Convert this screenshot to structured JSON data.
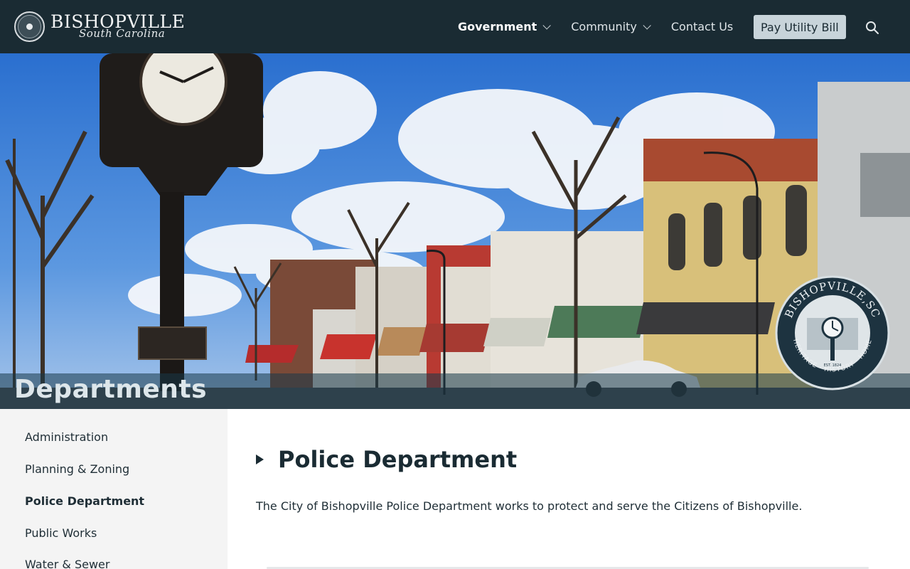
{
  "header": {
    "brand_name": "BISHOPVILLE",
    "brand_script": "South Carolina",
    "logo_icon": "city-seal-icon",
    "nav": [
      {
        "label": "Government",
        "has_dropdown": true,
        "active": true
      },
      {
        "label": "Community",
        "has_dropdown": true,
        "active": false
      },
      {
        "label": "Contact Us",
        "has_dropdown": false,
        "active": false
      }
    ],
    "pay_button": "Pay Utility Bill",
    "search_icon": "search-icon"
  },
  "hero": {
    "title": "Departments",
    "badge": {
      "top_text": "BISHOPVILLE,SC",
      "bottom_text": "HERITAGE · HISTORY · HOME",
      "est": "EST. 1824"
    }
  },
  "sidebar": {
    "items": [
      {
        "label": "Administration",
        "active": false
      },
      {
        "label": "Planning & Zoning",
        "active": false
      },
      {
        "label": "Police Department",
        "active": true
      },
      {
        "label": "Public Works",
        "active": false
      },
      {
        "label": "Water & Sewer",
        "active": false
      }
    ]
  },
  "main": {
    "title": "Police Department",
    "intro": "The City of Bishopville Police Department works to protect and serve the Citizens of Bishopville."
  }
}
